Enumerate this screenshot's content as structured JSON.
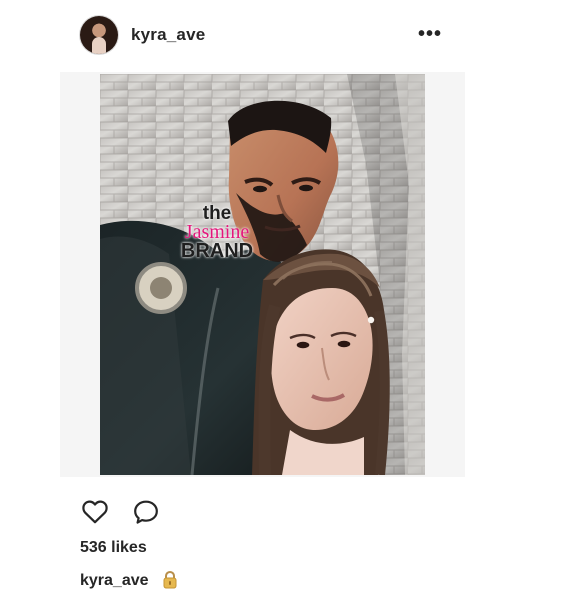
{
  "post": {
    "username": "kyra_ave",
    "more_icon": "more-horizontal-icon",
    "likes_text": "536 likes",
    "caption_username": "kyra_ave",
    "icons": {
      "like": "heart-icon",
      "comment": "comment-icon",
      "caption_emoji": "lock-icon"
    },
    "watermark": {
      "line1": "the",
      "line2": "Jasmine",
      "line3": "BRAND"
    },
    "colors": {
      "text": "#262626",
      "watermark_accent": "#e4167c",
      "lock": "#e6b84f"
    }
  }
}
